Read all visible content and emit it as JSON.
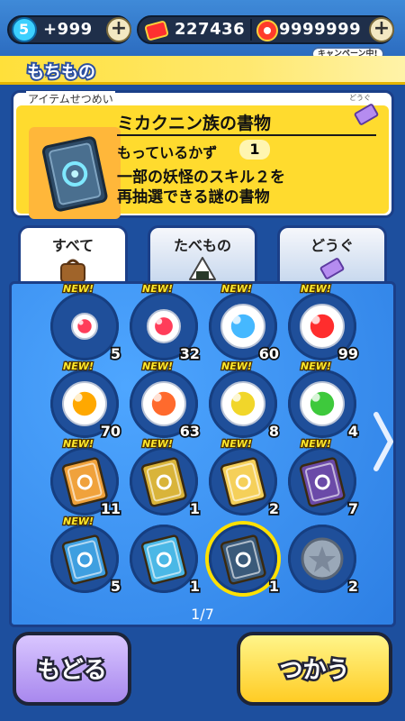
{
  "header": {
    "level": "5",
    "coins": "+999",
    "money": "227436",
    "points": "9999999",
    "campaign": "キャンペーン中!"
  },
  "title": "もちもの",
  "description": {
    "section_label": "アイテムせつめい",
    "type_tag": "どうぐ",
    "item_name": "ミカクニン族の書物",
    "count_label": "もっているかず",
    "count_value": "1",
    "text_line1": "一部の妖怪のスキル２を",
    "text_line2": "再抽選できる謎の書物"
  },
  "tabs": [
    {
      "label": "すべて",
      "icon": "bag-icon",
      "active": true
    },
    {
      "label": "たべもの",
      "icon": "onigiri-icon",
      "active": false
    },
    {
      "label": "どうぐ",
      "icon": "ticket-icon",
      "active": false
    }
  ],
  "items": [
    {
      "kind": "orb-small",
      "new": "NEW!",
      "count": "5",
      "color": "#ff3d5a"
    },
    {
      "kind": "orb-medium",
      "new": "NEW!",
      "count": "32",
      "color": "#ff3d5a"
    },
    {
      "kind": "orb-blue",
      "new": "NEW!",
      "count": "60",
      "color": "#45b8ff"
    },
    {
      "kind": "orb-big",
      "new": "NEW!",
      "count": "99",
      "color": "#ff2d2d"
    },
    {
      "kind": "orb-fire",
      "new": "NEW!",
      "count": "70",
      "color": "#ffa800"
    },
    {
      "kind": "orb-crystal",
      "new": "NEW!",
      "count": "63",
      "color": "#ff6a2d"
    },
    {
      "kind": "orb-gold",
      "new": "NEW!",
      "count": "8",
      "color": "#f1d62a"
    },
    {
      "kind": "orb-jewel",
      "new": "NEW!",
      "count": "4",
      "color": "#3ec93c"
    },
    {
      "kind": "book-orange",
      "new": "NEW!",
      "count": "11",
      "color": "#f0a23c"
    },
    {
      "kind": "book-gold",
      "new": "NEW!",
      "count": "1",
      "color": "#d9b43a"
    },
    {
      "kind": "book-fancy",
      "new": "NEW!",
      "count": "2",
      "color": "#f5d05a"
    },
    {
      "kind": "book-purple",
      "new": "NEW!",
      "count": "7",
      "color": "#6b4aa8"
    },
    {
      "kind": "book-blue",
      "new": "NEW!",
      "count": "5",
      "color": "#3f9fe0"
    },
    {
      "kind": "book-cyan",
      "new": "",
      "count": "1",
      "color": "#4bb8e6"
    },
    {
      "kind": "book-dark",
      "new": "",
      "count": "1",
      "color": "#3a5a7a",
      "selected": true
    },
    {
      "kind": "coin-star",
      "new": "",
      "count": "2",
      "color": "#9aa8b8"
    }
  ],
  "pager": "1/7",
  "buttons": {
    "back": "もどる",
    "use": "つかう"
  },
  "colors": {
    "accent_yellow": "#ffdb2e",
    "panel_blue": "#2d7fe4",
    "back_purple": "#a888ee",
    "use_yellow": "#ffcc24"
  }
}
